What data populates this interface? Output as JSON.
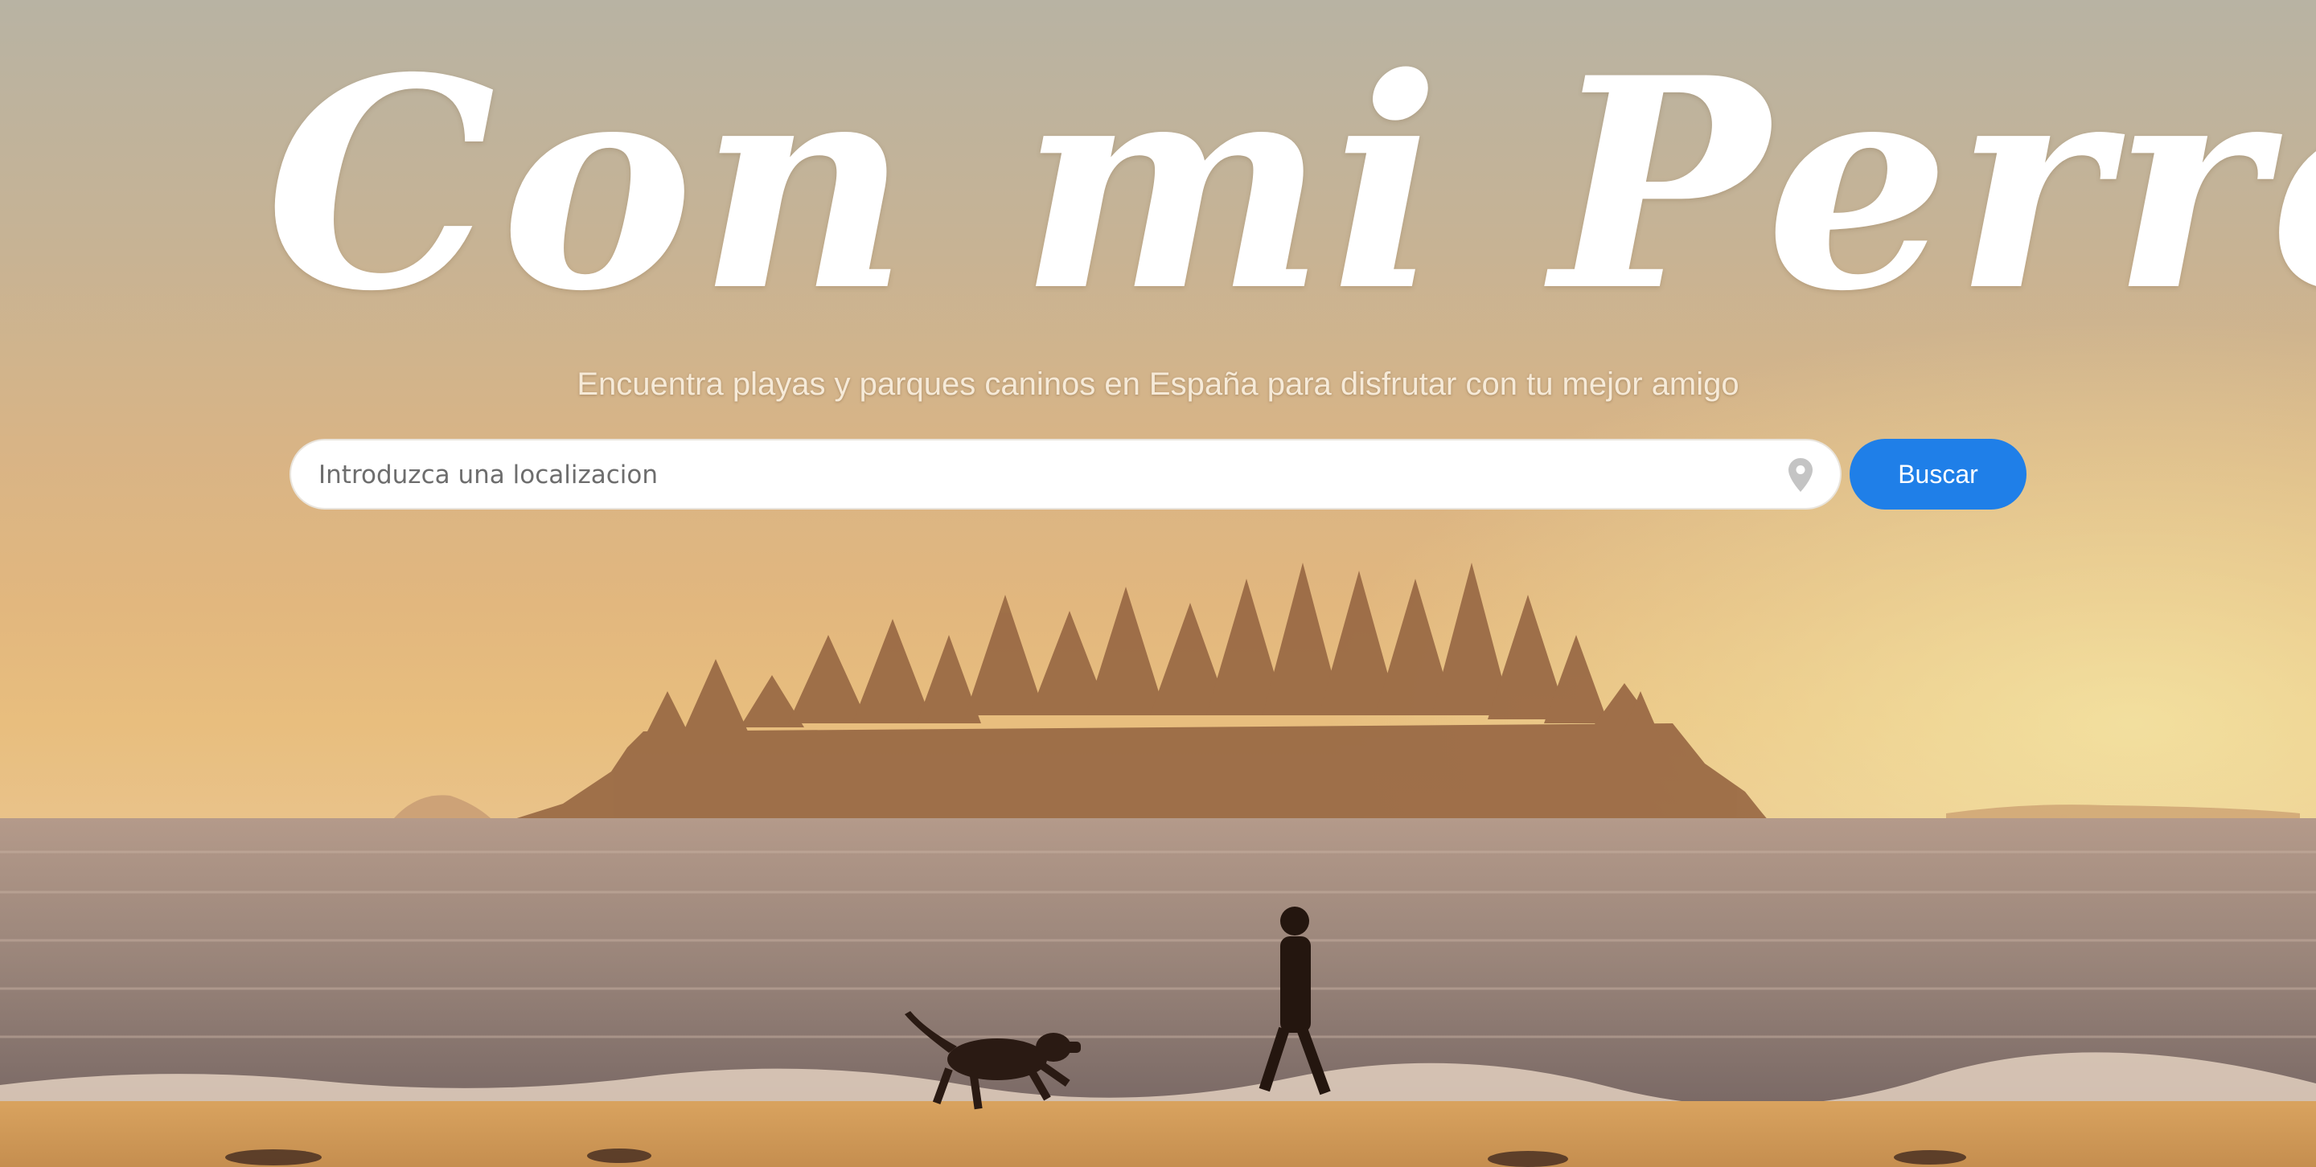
{
  "hero": {
    "title": "Con mi Perrete",
    "tagline": "Encuentra playas y parques caninos en España para disfrutar con tu mejor amigo"
  },
  "search": {
    "placeholder": "Introduzca una localizacion",
    "value": "",
    "location_icon": "map-pin-icon",
    "button_label": "Buscar"
  },
  "colors": {
    "accent": "#1f7fe8",
    "title_text": "#ffffff",
    "sky_top": "#b8b3a3",
    "sky_horizon": "#e9c289"
  }
}
